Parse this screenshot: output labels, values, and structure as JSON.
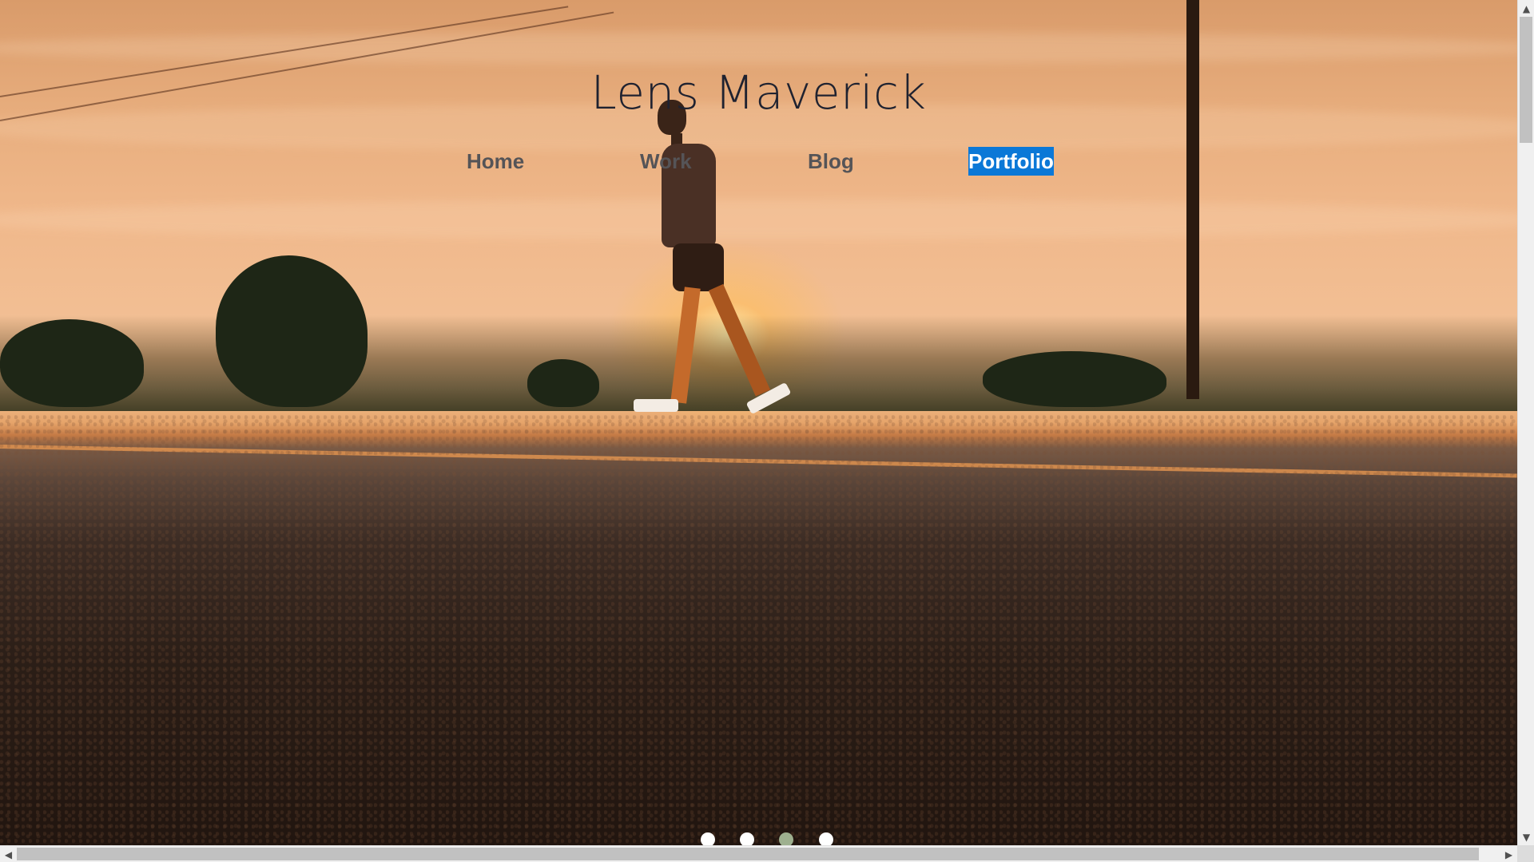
{
  "site": {
    "title": "Lens Maverick"
  },
  "nav": {
    "items": [
      {
        "label": "Home",
        "selected": false
      },
      {
        "label": "Work",
        "selected": false
      },
      {
        "label": "Blog",
        "selected": false
      },
      {
        "label": "Portfolio",
        "selected": true
      }
    ]
  },
  "hero": {
    "image_subject": "person walking on road at sunset",
    "slides_total": 4,
    "active_slide": 3
  },
  "scrollbars": {
    "vertical_up_icon": "chevron-up-icon",
    "vertical_down_icon": "chevron-down-icon",
    "horizontal_left_icon": "chevron-left-icon",
    "horizontal_right_icon": "chevron-right-icon"
  },
  "colors": {
    "nav_selected_bg": "#0b78d7",
    "nav_text": "#555457",
    "title_text": "#1f2230",
    "active_dot": "#9eb08f",
    "dot": "#ffffff"
  }
}
